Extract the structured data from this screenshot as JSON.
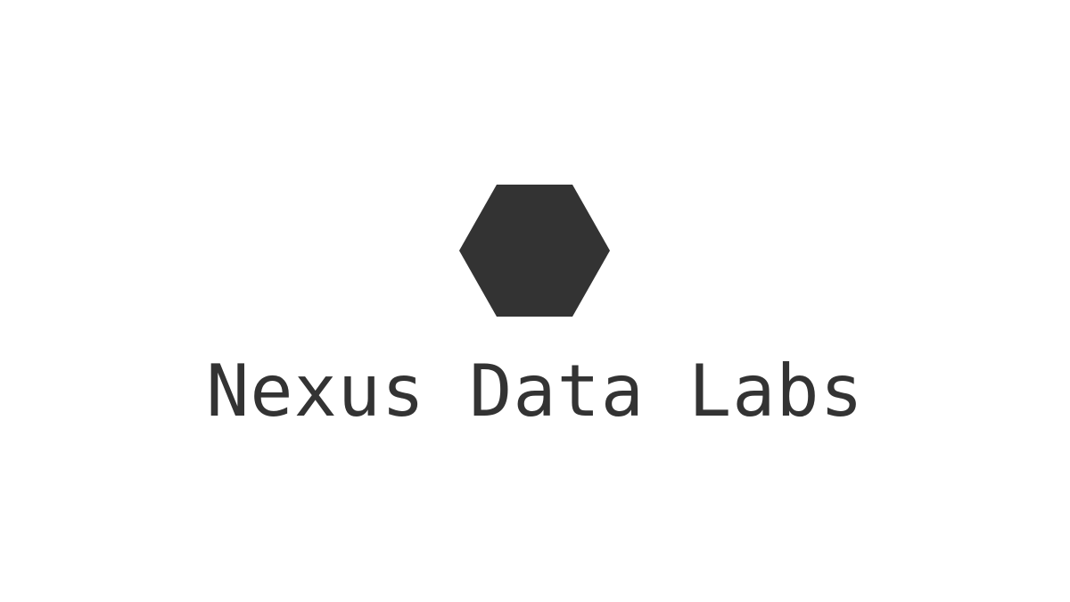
{
  "brand": {
    "name": "Nexus Data Labs",
    "logo_icon": "hexagon-icon",
    "color": "#333333",
    "background": "#ffffff"
  }
}
